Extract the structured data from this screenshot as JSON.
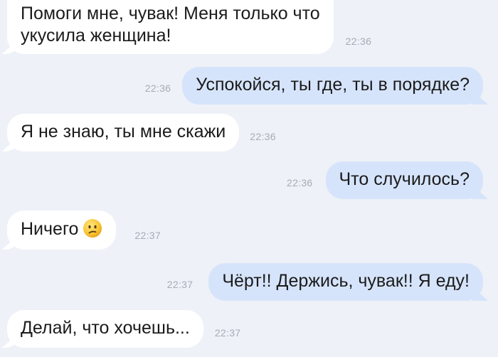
{
  "messages": [
    {
      "side": "in",
      "lines": [
        "Помоги мне, чувак! Меня только что",
        "укусила женщина!"
      ],
      "time": "22:36"
    },
    {
      "side": "out",
      "text": "Успокойся, ты где, ты в порядке?",
      "time": "22:36"
    },
    {
      "side": "in",
      "text": "Я не знаю, ты мне скажи",
      "time": "22:36"
    },
    {
      "side": "out",
      "text": "Что случилось?",
      "time": "22:36"
    },
    {
      "side": "in",
      "text": "Ничего",
      "emoji": "confused-face-icon",
      "time": "22:37"
    },
    {
      "side": "out",
      "text": "Чёрт!! Держись, чувак!! Я еду!",
      "time": "22:37"
    },
    {
      "side": "in",
      "text": "Делай, что хочешь...",
      "time": "22:37"
    }
  ],
  "colors": {
    "background": "#eef1f7",
    "incoming_bubble": "#ffffff",
    "outgoing_bubble": "#d6e4fb",
    "timestamp": "#a7abb4",
    "text": "#1b1b1b"
  }
}
